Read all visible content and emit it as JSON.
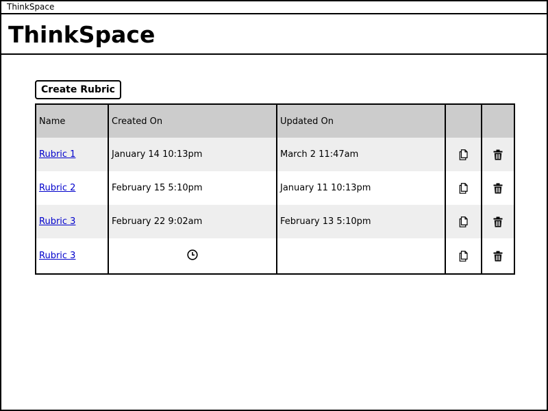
{
  "window": {
    "title": "ThinkSpace"
  },
  "header": {
    "app_title": "ThinkSpace"
  },
  "toolbar": {
    "create_label": "Create Rubric"
  },
  "table": {
    "columns": [
      "Name",
      "Created On",
      "Updated On",
      "",
      ""
    ],
    "rows": [
      {
        "name": "Rubric 1",
        "created": "January 14 10:13pm",
        "updated": "March 2 11:47am",
        "status": "done"
      },
      {
        "name": "Rubric 2",
        "created": "February 15 5:10pm",
        "updated": "January 11 10:13pm",
        "status": "done"
      },
      {
        "name": "Rubric 3",
        "created": "February 22 9:02am",
        "updated": "February 13 5:10pm",
        "status": "done"
      },
      {
        "name": "Rubric 3",
        "created": "",
        "updated": "",
        "status": "pending"
      }
    ]
  },
  "icons": {
    "copy": "copy-icon",
    "delete": "trash-icon",
    "pending": "clock-icon"
  },
  "colors": {
    "header_bg": "#cccccc",
    "stripe_bg": "#eeeeee",
    "link": "#0000cc",
    "border": "#000000"
  }
}
